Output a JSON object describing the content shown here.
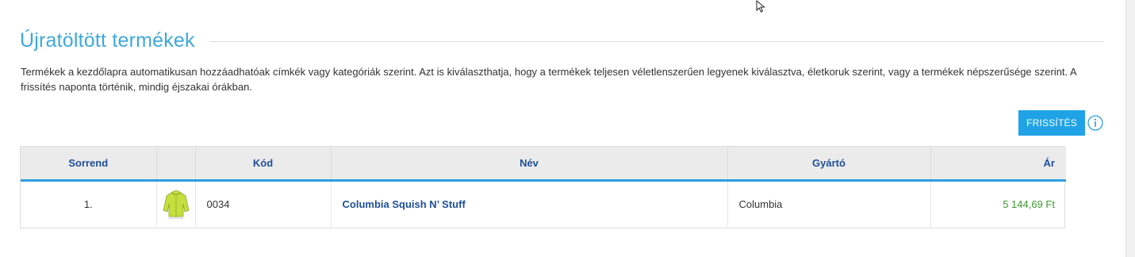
{
  "section": {
    "title": "Újratöltött termékek",
    "description": "Termékek a kezdőlapra automatikusan hozzáadhatóak címkék vagy kategóriák szerint. Azt is kiválaszthatja, hogy a termékek teljesen véletlenszerűen legyenek kiválasztva, életkoruk szerint, vagy a termékek népszerűsége szerint. A frissítés naponta történik, mindig éjszakai órákban."
  },
  "toolbar": {
    "refresh_label": "FRISSÍTÉS",
    "info_icon": "info-circle-icon"
  },
  "table": {
    "headers": {
      "order": "Sorrend",
      "image": "",
      "code": "Kód",
      "name": "Név",
      "manufacturer": "Gyártó",
      "price": "Ár"
    },
    "rows": [
      {
        "order": "1.",
        "image_icon": "green-jacket-thumbnail",
        "code": "0034",
        "name": "Columbia Squish N’ Stuff",
        "manufacturer": "Columbia",
        "price": "5 144,69 Ft"
      }
    ]
  },
  "colors": {
    "accent": "#1fa3e6",
    "title": "#3ba9dd",
    "header_text": "#1f4f99",
    "price": "#3a9a2e"
  }
}
